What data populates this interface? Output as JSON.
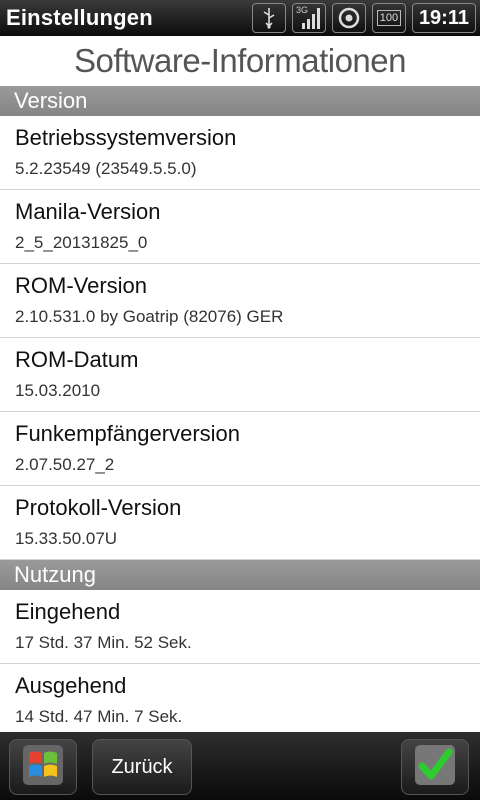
{
  "statusbar": {
    "app_title": "Einstellungen",
    "network_label": "3G",
    "battery_label": "100",
    "time": "19:11",
    "icons": [
      "usb-icon",
      "signal-icon",
      "sync-icon",
      "battery-icon"
    ]
  },
  "header": {
    "title": "Software-Informationen"
  },
  "sections": [
    {
      "label": "Version",
      "items": [
        {
          "title": "Betriebssystemversion",
          "value": "5.2.23549 (23549.5.5.0)"
        },
        {
          "title": "Manila-Version",
          "value": "2_5_20131825_0"
        },
        {
          "title": "ROM-Version",
          "value": "2.10.531.0 by Goatrip (82076) GER"
        },
        {
          "title": "ROM-Datum",
          "value": "15.03.2010"
        },
        {
          "title": "Funkempfängerversion",
          "value": "2.07.50.27_2"
        },
        {
          "title": "Protokoll-Version",
          "value": "15.33.50.07U"
        }
      ]
    },
    {
      "label": "Nutzung",
      "items": [
        {
          "title": "Eingehend",
          "value": "17 Std. 37 Min. 52 Sek."
        },
        {
          "title": "Ausgehend",
          "value": "14 Std. 47 Min. 7 Sek."
        }
      ]
    }
  ],
  "bottombar": {
    "back_label": "Zurück",
    "start_icon": "windows-start-icon",
    "ok_icon": "checkmark-icon"
  }
}
